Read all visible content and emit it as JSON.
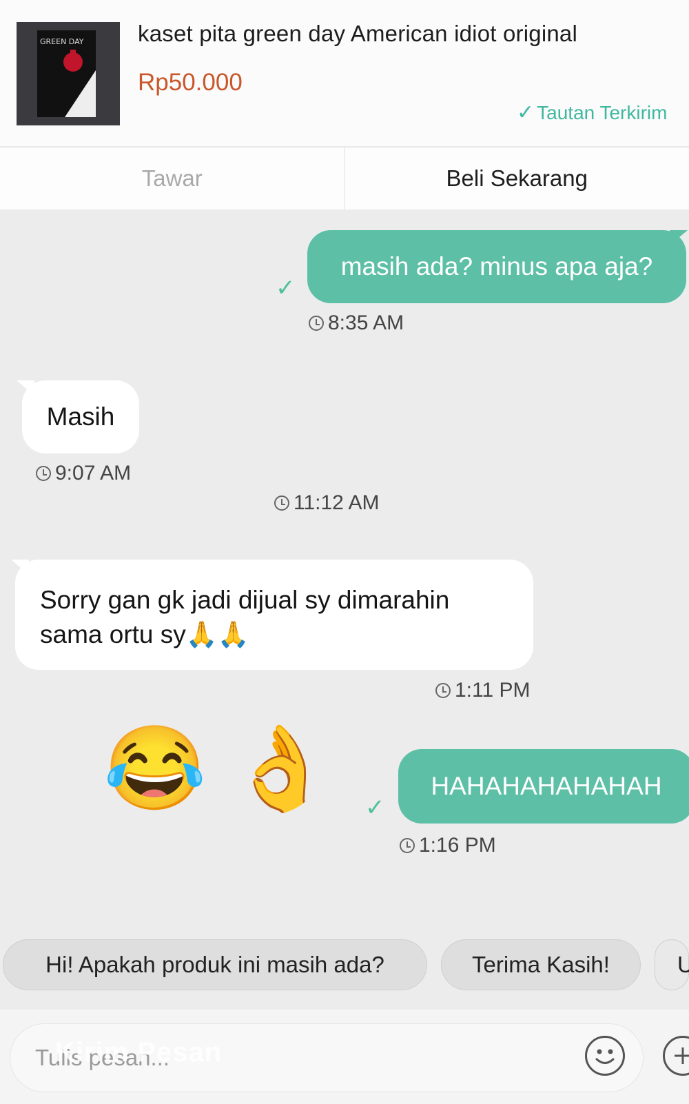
{
  "product": {
    "title": "kaset pita green day American idiot original",
    "price": "Rp50.000",
    "link_status": "Tautan Terkirim",
    "thumbnail_text": "GREEN DAY"
  },
  "actions": {
    "offer_label": "Tawar",
    "buy_label": "Beli Sekarang"
  },
  "messages": [
    {
      "text": "masih ada? minus apa aja?",
      "time": "8:35 AM"
    },
    {
      "text": "Masih",
      "time": "9:07 AM"
    },
    {
      "divider_time": "11:12 AM"
    },
    {
      "text": "Sorry gan gk jadi dijual sy dimarahin sama ortu sy🙏🙏",
      "time": "1:11 PM"
    },
    {
      "emoji": "😂 👌"
    },
    {
      "text": "HAHAHAHAHAHAH",
      "time": "1:16 PM"
    }
  ],
  "quick_replies": [
    "Hi! Apakah produk ini masih ada?",
    "Terima Kasih!",
    "U"
  ],
  "input": {
    "placeholder": "Tulis pesan...",
    "watermark": "Kirim Pesan"
  }
}
